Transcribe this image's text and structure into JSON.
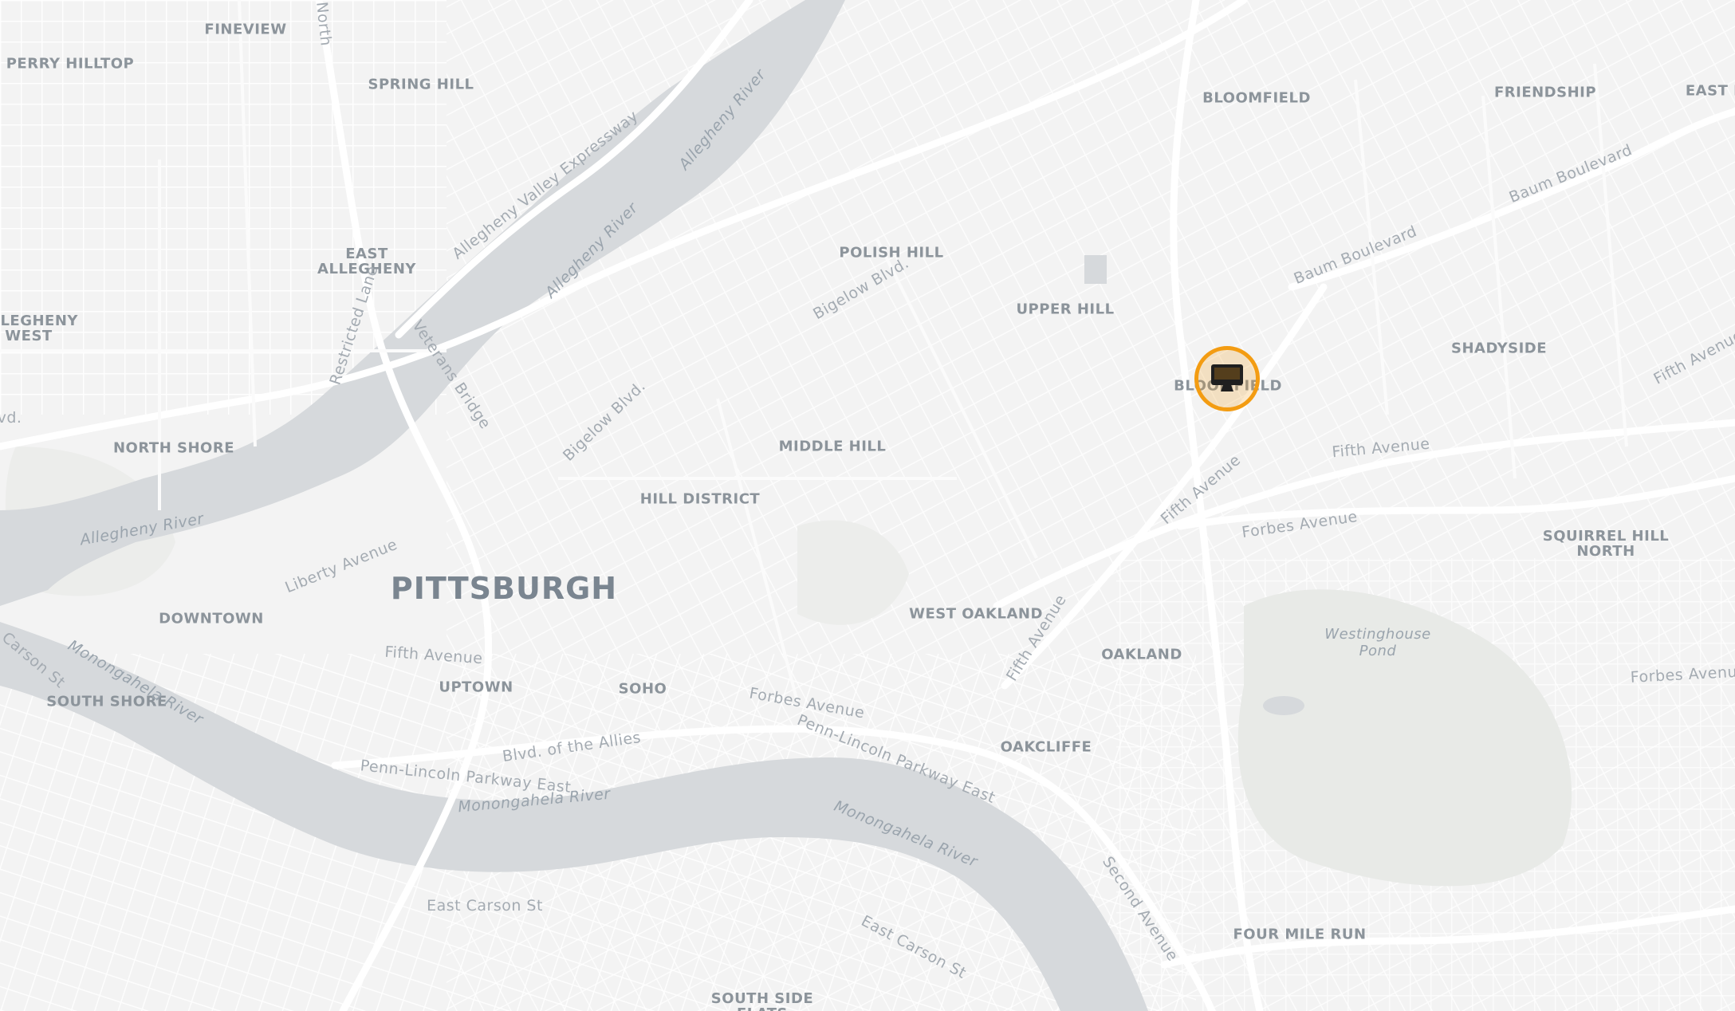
{
  "map": {
    "colors": {
      "land": "#f3f3f3",
      "water": "#d6d9dc",
      "road": "#ffffff",
      "park": "#e9ebe8",
      "marker": "#f39c12"
    },
    "marker": {
      "icon": "monitor-icon"
    },
    "city_label": "PITTSBURGH",
    "neighborhoods": [
      "FINEVIEW",
      "PERRY HILLTOP",
      "SPRING HILL",
      "EAST\nALLEGHENY",
      "ALLEGHENY\nWEST",
      "NORTH SHORE",
      "DOWNTOWN",
      "SOUTH SHORE",
      "UPTOWN",
      "SOHO",
      "HILL DISTRICT",
      "MIDDLE HILL",
      "POLISH HILL",
      "UPPER HILL",
      "WEST OAKLAND",
      "OAKLAND",
      "OAKCLIFFE",
      "BLOOMFIELD",
      "FRIENDSHIP",
      "EAST L",
      "SHADYSIDE",
      "BLOOMFIELD",
      "SQUIRREL HILL\nNORTH",
      "FOUR MILE RUN",
      "SOUTH SIDE\nFLATS"
    ],
    "roads": [
      "Allegheny Valley Expressway",
      "Restricted Lane",
      "Veterans Bridge",
      "Bigelow Blvd.",
      "Bigelow Blvd.",
      "Liberty Avenue",
      "Fifth Avenue",
      "Forbes Avenue",
      "Blvd. of the Allies",
      "Penn-Lincoln Parkway East",
      "Penn-Lincoln Parkway East",
      "Fifth Avenue",
      "Fifth Avenue",
      "Fifth Avenue",
      "Forbes Avenue",
      "Forbes Avenue",
      "Baum Boulevard",
      "Baum Boulevard",
      "Fifth Avenue",
      "Second Avenue",
      "East Carson St",
      "East Carson St",
      "Carson St",
      "North",
      "vd."
    ],
    "rivers": [
      "Allegheny River",
      "Allegheny River",
      "Allegheny River",
      "Monongahela River",
      "Monongahela River",
      "Monongahela River"
    ],
    "ponds": [
      "Westinghouse\nPond"
    ]
  }
}
